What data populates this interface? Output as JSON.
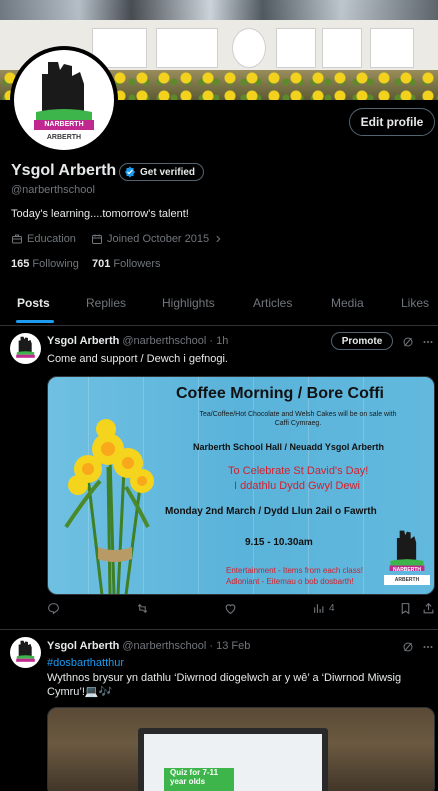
{
  "profile": {
    "name": "Ysgol Arberth",
    "handle": "@narberthschool",
    "bio": "Today's learning....tomorrow's talent!",
    "category": "Education",
    "joined": "Joined October 2015",
    "following_count": "165",
    "following_label": "Following",
    "followers_count": "701",
    "followers_label": "Followers",
    "edit_label": "Edit profile",
    "verify_label": "Get verified",
    "avatar_text_1": "NARBERTH",
    "avatar_text_2": "ARBERTH"
  },
  "tabs": [
    {
      "label": "Posts",
      "active": true
    },
    {
      "label": "Replies"
    },
    {
      "label": "Highlights"
    },
    {
      "label": "Articles"
    },
    {
      "label": "Media"
    },
    {
      "label": "Likes"
    }
  ],
  "posts": [
    {
      "author": "Ysgol Arberth",
      "handle": "@narberthschool",
      "time": "· 1h",
      "promote_label": "Promote",
      "text": "Come and support / Dewch i gefnogi.",
      "image": {
        "title": "Coffee Morning / Bore Coffi",
        "subtitle": "Tea/Coffee/Hot Chocolate and Welsh Cakes will be on sale with Caffi Cymraeg.",
        "venue": "Narberth School Hall / Neuadd Ysgol Arberth",
        "reason_en": "To Celebrate St David's Day!",
        "reason_cy": "I ddathlu Dydd Gwyl Dewi",
        "date": "Monday 2nd March / Dydd Llun 2ail o Fawrth",
        "time": "9.15 - 10.30am",
        "ent_en": "Entertainment - Items from each class!",
        "ent_cy": "Adloniant - Eitemau o bob dosbarth!",
        "logo_text_1": "NARBERTH",
        "logo_text_2": "ARBERTH"
      },
      "views": "4"
    },
    {
      "author": "Ysgol Arberth",
      "handle": "@narberthschool",
      "time": "· 13 Feb",
      "hashtag": "#dosbarthatthur",
      "text_line1": "Wythnos brysur yn dathlu ‘Diwrnod diogelwch ar y wê’ a ‘Diwrnod Miwsig",
      "text_line2": "Cymru’!💻🎶",
      "image_text_1": "Quiz for 7-11",
      "image_text_2": "year olds"
    }
  ],
  "colors": {
    "accent": "#1d9bf0",
    "background": "#000000",
    "text": "#e7e9ea",
    "muted": "#71767b",
    "border": "#2f3336",
    "logo_green": "#3db54a",
    "logo_purple": "#c0278f"
  }
}
